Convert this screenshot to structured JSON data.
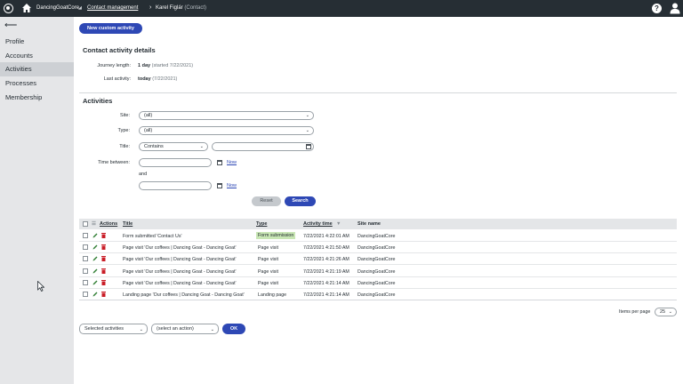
{
  "topbar": {
    "site_name": "DancingGoatCore",
    "breadcrumb_link": "Contact management",
    "breadcrumb_current": "Karel Figlár",
    "breadcrumb_sub": "(Contact)",
    "help": "?"
  },
  "sidebar": {
    "items": [
      {
        "label": "Profile"
      },
      {
        "label": "Accounts"
      },
      {
        "label": "Activities"
      },
      {
        "label": "Processes"
      },
      {
        "label": "Membership"
      }
    ]
  },
  "main": {
    "new_button": "New custom activity",
    "details_title": "Contact activity details",
    "journey_label": "Journey length:",
    "journey_value": "1 day",
    "journey_extra": "(started 7/22/2021)",
    "last_label": "Last activity:",
    "last_value": "today",
    "last_extra": "(7/22/2021)",
    "activities_title": "Activities"
  },
  "filter": {
    "site_label": "Site:",
    "site_value": "(all)",
    "type_label": "Type:",
    "type_value": "(all)",
    "title_label": "Title:",
    "title_operator": "Contains",
    "time_label": "Time between:",
    "now_label": "Now",
    "and_label": "and",
    "reset_label": "Reset",
    "search_label": "Search"
  },
  "table": {
    "headers": {
      "actions": "Actions",
      "title": "Title",
      "type": "Type",
      "time": "Activity time",
      "site": "Site name"
    },
    "rows": [
      {
        "title": "Form submitted 'Contact Us'",
        "type": "Form submission",
        "time": "7/22/2021 4:22:01 AM",
        "site": "DancingGoatCore",
        "badge": true
      },
      {
        "title": "Page visit 'Our coffees | Dancing Goat - Dancing Goat'",
        "type": "Page visit",
        "time": "7/22/2021 4:21:50 AM",
        "site": "DancingGoatCore",
        "badge": false
      },
      {
        "title": "Page visit 'Our coffees | Dancing Goat - Dancing Goat'",
        "type": "Page visit",
        "time": "7/22/2021 4:21:26 AM",
        "site": "DancingGoatCore",
        "badge": false
      },
      {
        "title": "Page visit 'Our coffees | Dancing Goat - Dancing Goat'",
        "type": "Page visit",
        "time": "7/22/2021 4:21:19 AM",
        "site": "DancingGoatCore",
        "badge": false
      },
      {
        "title": "Page visit 'Our coffees | Dancing Goat - Dancing Goat'",
        "type": "Page visit",
        "time": "7/22/2021 4:21:14 AM",
        "site": "DancingGoatCore",
        "badge": false
      },
      {
        "title": "Landing page 'Our coffees | Dancing Goat - Dancing Goat'",
        "type": "Landing page",
        "time": "7/22/2021 4:21:14 AM",
        "site": "DancingGoatCore",
        "badge": false
      }
    ]
  },
  "pager": {
    "items_label": "Items per page",
    "items_value": "25"
  },
  "bulk": {
    "scope_value": "Selected activities",
    "action_value": "(select an action)",
    "ok_label": "OK"
  },
  "colors": {
    "topbar": "#262e34",
    "sidebar": "#e5e6e8",
    "primary": "#2e48b5",
    "badge": "#c8e6b4",
    "delete": "#c91d27",
    "edit": "#2f7d32"
  }
}
